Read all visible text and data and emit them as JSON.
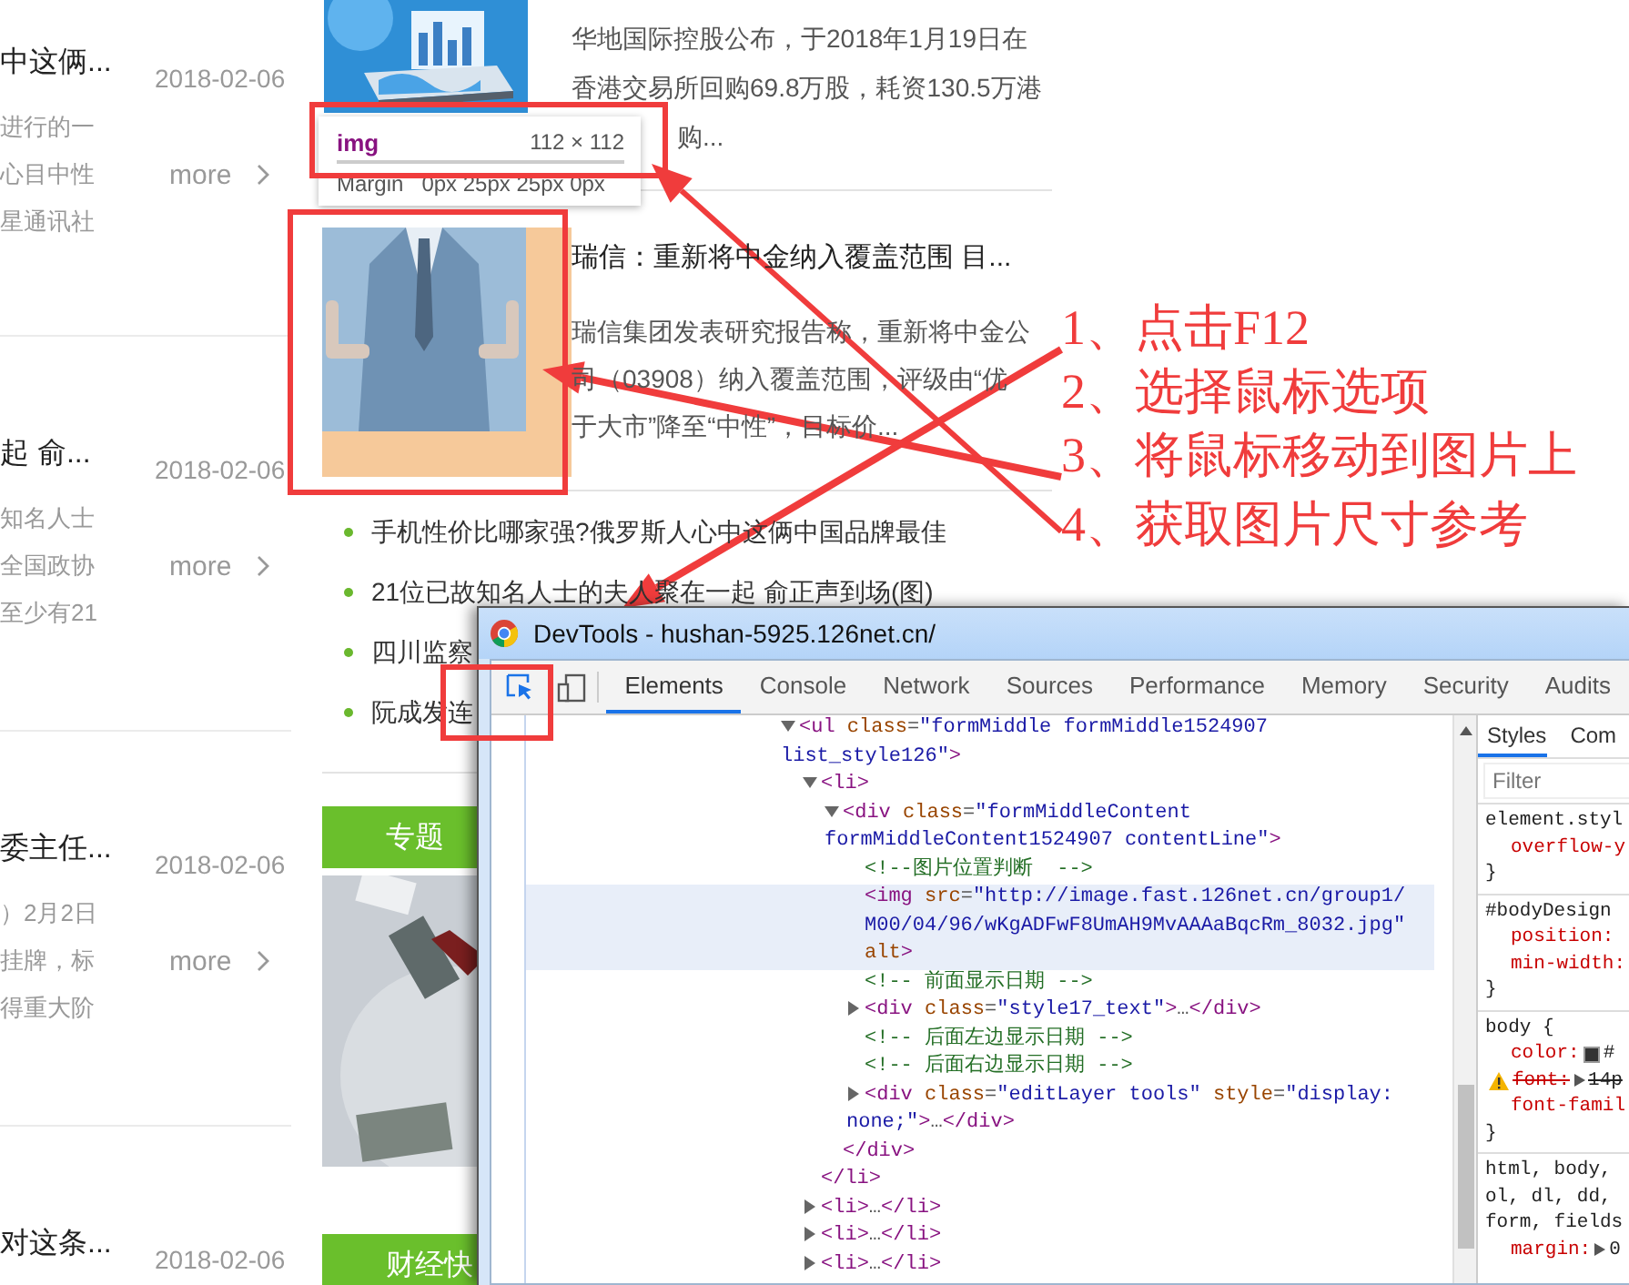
{
  "news_list": [
    {
      "title": "中这俩...",
      "date": "2018-02-06",
      "summary": [
        "进行的一",
        "心目中性",
        "星通讯社"
      ],
      "more": "more"
    },
    {
      "title": "起 俞...",
      "date": "2018-02-06",
      "summary": [
        "知名人士",
        "全国政协",
        "至少有21"
      ],
      "more": "more"
    },
    {
      "title": "委主任...",
      "date": "2018-02-06",
      "summary": [
        "）2月2日",
        "挂牌，标",
        "得重大阶"
      ],
      "more": "more"
    },
    {
      "title": "对这条...",
      "date": "2018-02-06"
    }
  ],
  "articles": [
    {
      "image": {
        "kind": "picture"
      },
      "summary": [
        "华地国际控股公布，于2018年1月19日在",
        "香港交易所回购69.8万股，耗资130.5万港",
        "购..."
      ]
    },
    {
      "image": {
        "kind": "picture"
      },
      "title": "瑞信：重新将中金纳入覆盖范围 目...",
      "summary": [
        "瑞信集团发表研究报告称，重新将中金公",
        "司（03908）纳入覆盖范围，评级由“优",
        "于大市”降至“中性”，目标价..."
      ]
    }
  ],
  "headlines": [
    {
      "text": "手机性价比哪家强?俄罗斯人心中这俩中国品牌最佳"
    },
    {
      "text": "21位已故知名人士的夫人聚在一起 俞正声到场(图)"
    },
    {
      "text": "四川监察"
    },
    {
      "text": "阮成发连"
    }
  ],
  "sections": [
    {
      "label": "专题",
      "image": {
        "kind": "picture"
      }
    },
    {
      "label": "财经快"
    }
  ],
  "inspector_tooltip": {
    "tag": "img",
    "size": "112 × 112",
    "margin_label": "Margin",
    "margin_value": "0px 25px 25px 0px"
  },
  "annotations": {
    "steps": [
      "1、点击F12",
      "2、选择鼠标选项",
      "3、将鼠标移动到图片上",
      "4、获取图片尺寸参考"
    ]
  },
  "devtools": {
    "title": "DevTools - hushan-5925.126net.cn/",
    "tabs": [
      {
        "label": "Elements",
        "selected": true
      },
      {
        "label": "Console",
        "selected": false
      },
      {
        "label": "Network",
        "selected": false
      },
      {
        "label": "Sources",
        "selected": false
      },
      {
        "label": "Performance",
        "selected": false
      },
      {
        "label": "Memory",
        "selected": false
      },
      {
        "label": "Security",
        "selected": false
      },
      {
        "label": "Audits",
        "selected": false
      }
    ],
    "dom_tree": [
      {
        "kind": "element",
        "expanded": true,
        "selected": false,
        "lines": [
          "<ul class=\"formMiddle formMiddle1524907",
          "list_style126\">"
        ],
        "children": [
          {
            "kind": "element",
            "expanded": true,
            "selected": false,
            "lines": [
              "<li>"
            ],
            "close": "</li>",
            "children": [
              {
                "kind": "element",
                "expanded": true,
                "selected": false,
                "lines": [
                  "<div class=\"formMiddleContent",
                  "formMiddleContent1524907 contentLine\">"
                ],
                "close": "</div>",
                "children": [
                  {
                    "kind": "comment",
                    "selected": false,
                    "lines": [
                      "<!--图片位置判断  -->"
                    ]
                  },
                  {
                    "kind": "leaf",
                    "selected": true,
                    "lines": [
                      "<img src=\"http://image.fast.126net.cn/group1/",
                      "M00/04/96/wKgADFwF8UmAH9MvAAAaBqcRm_8032.jpg\"",
                      "alt>"
                    ]
                  },
                  {
                    "kind": "comment",
                    "selected": false,
                    "lines": [
                      "<!-- 前面显示日期 -->"
                    ]
                  },
                  {
                    "kind": "element",
                    "expanded": false,
                    "selected": false,
                    "lines": [
                      "<div class=\"style17_text\">…</div>"
                    ]
                  },
                  {
                    "kind": "comment",
                    "selected": false,
                    "lines": [
                      "<!-- 后面左边显示日期 -->"
                    ]
                  },
                  {
                    "kind": "comment",
                    "selected": false,
                    "lines": [
                      "<!-- 后面右边显示日期 -->"
                    ]
                  },
                  {
                    "kind": "element",
                    "expanded": false,
                    "selected": false,
                    "lines": [
                      "<div class=\"editLayer tools\" style=\"display:",
                      "none;\">…</div>"
                    ]
                  }
                ]
              }
            ]
          },
          {
            "kind": "element",
            "expanded": false,
            "selected": false,
            "lines": [
              "<li>…</li>"
            ]
          },
          {
            "kind": "element",
            "expanded": false,
            "selected": false,
            "lines": [
              "<li>…</li>"
            ]
          },
          {
            "kind": "element",
            "expanded": false,
            "selected": false,
            "lines": [
              "<li>…</li>"
            ]
          }
        ]
      }
    ],
    "styles_tabs": [
      {
        "label": "Styles",
        "selected": true
      },
      {
        "label": "Com",
        "selected": false
      }
    ],
    "filter": {
      "placeholder": "Filter"
    },
    "style_rules": [
      {
        "selector": [
          "element.styl"
        ],
        "props": [
          {
            "kind": "plain",
            "name": "overflow-y",
            "overridden": false
          }
        ],
        "close": "}"
      },
      {
        "selector": [
          "#bodyDesign"
        ],
        "props": [
          {
            "kind": "plain",
            "name": "position:",
            "overridden": false
          },
          {
            "kind": "plain",
            "name": "min-width:",
            "overridden": false
          }
        ],
        "close": "}"
      },
      {
        "selector": [
          "body {"
        ],
        "props": [
          {
            "kind": "color",
            "name": "color:",
            "value": "#",
            "overridden": false
          },
          {
            "kind": "shorthand",
            "name": "font:",
            "value": "14p",
            "overridden": true
          },
          {
            "kind": "plain",
            "name": "font-famil",
            "overridden": false
          }
        ],
        "close": "}"
      },
      {
        "selector": [
          "html, body,",
          "ol, dl, dd,",
          "form, fields"
        ],
        "props": [
          {
            "kind": "shorthand",
            "name": "margin:",
            "value": "0",
            "overridden": false
          }
        ]
      }
    ]
  }
}
